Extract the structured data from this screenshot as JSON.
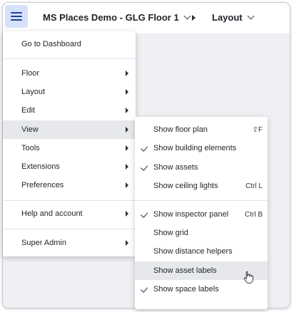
{
  "header": {
    "title": "MS Places Demo - GLG Floor 1",
    "layout_label": "Layout"
  },
  "main_menu": {
    "go_dashboard": "Go to Dashboard",
    "items": [
      "Floor",
      "Layout",
      "Edit",
      "View",
      "Tools",
      "Extensions",
      "Preferences"
    ],
    "help": "Help and account",
    "super_admin": "Super Admin"
  },
  "view_menu": {
    "items": [
      {
        "label": "Show floor plan",
        "shortcut": "⇧F",
        "checked": false
      },
      {
        "label": "Show building elements",
        "shortcut": "",
        "checked": true
      },
      {
        "label": "Show assets",
        "shortcut": "",
        "checked": true
      },
      {
        "label": "Show ceiling lights",
        "shortcut": "Ctrl L",
        "checked": false
      },
      {
        "label": "Show inspector panel",
        "shortcut": "Ctrl B",
        "checked": true
      },
      {
        "label": "Show grid",
        "shortcut": "",
        "checked": false
      },
      {
        "label": "Show distance helpers",
        "shortcut": "",
        "checked": false
      },
      {
        "label": "Show asset labels",
        "shortcut": "",
        "checked": false
      },
      {
        "label": "Show space labels",
        "shortcut": "",
        "checked": true
      }
    ]
  },
  "icons": {
    "menu": "hamburger-icon",
    "dropdown": "chevron-down-icon",
    "breadcrumb": "caret-right-icon",
    "submenu": "caret-right-icon",
    "check": "check-icon",
    "cursor": "hand-pointer-icon"
  },
  "colors": {
    "menu_button_bg": "#d6e1fb",
    "menu_button_icon": "#1f3f9e",
    "hover_bg": "#e6e8ec"
  }
}
